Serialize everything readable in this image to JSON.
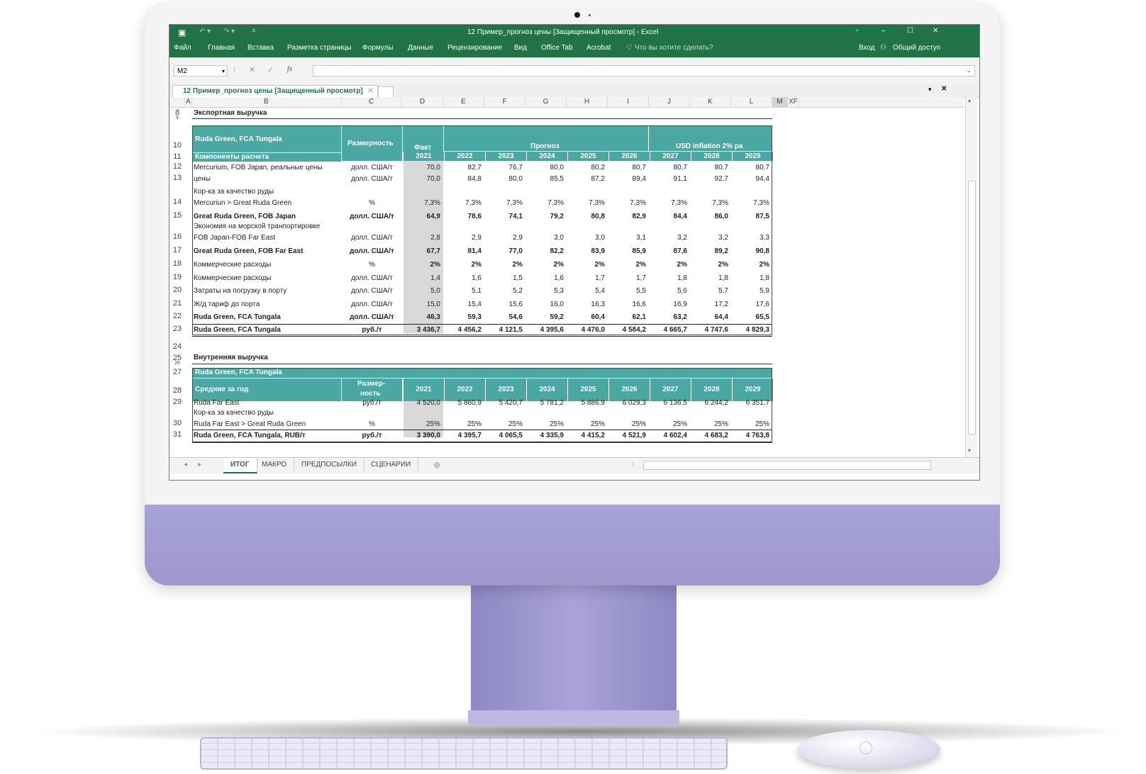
{
  "window": {
    "title": "12 Пример_прогноз цены  [Защищенный просмотр] - Excel",
    "controls": [
      "▫",
      "–",
      "☐",
      "✕"
    ]
  },
  "ribbon": {
    "tabs": [
      "Файл",
      "Главная",
      "Вставка",
      "Разметка страницы",
      "Формулы",
      "Данные",
      "Рецензирование",
      "Вид",
      "Office Tab",
      "Acrobat"
    ],
    "tell_me": "Что вы хотите сделать?",
    "signin": "Вход",
    "share": "Общий доступ"
  },
  "formula_bar": {
    "name_box": "M2",
    "fx": "fx",
    "value": ""
  },
  "doc_tab": {
    "label": "12 Пример_прогноз цены  [Защищенный просмотр]"
  },
  "columns": [
    "A",
    "B",
    "C",
    "D",
    "E",
    "F",
    "G",
    "H",
    "I",
    "J",
    "K",
    "L",
    "M",
    "XF"
  ],
  "section1": {
    "title": "Экспортная выручка",
    "header_entity": "Ruda Green, FCA Tungala",
    "header_components": "Компоненты расчета",
    "header_unit": "Размерность",
    "header_fact": "Факт",
    "header_forecast": "Прогноз",
    "header_inflation": "USD inflation 2% pa",
    "years": [
      "2021",
      "2022",
      "2023",
      "2024",
      "2025",
      "2026",
      "2027",
      "2028",
      "2029"
    ],
    "rows": [
      {
        "num": "12",
        "label": "Mercurium, FOB Japan, реальные цены",
        "unit": "долл. США/т",
        "vals": [
          "70,0",
          "82,7",
          "76,7",
          "80,0",
          "80,2",
          "80,7",
          "80,7",
          "80,7",
          "80,7"
        ]
      },
      {
        "num": "13",
        "label": "цены",
        "unit": "долл. США/т",
        "vals": [
          "70,0",
          "84,8",
          "80,0",
          "85,5",
          "87,2",
          "89,4",
          "91,1",
          "92,7",
          "94,4"
        ]
      },
      {
        "num": "14",
        "label": "Кор-ка за качество руды",
        "label2": "Mercuriun > Great Ruda Green",
        "unit": "%",
        "vals": [
          "7,3%",
          "7,3%",
          "7,3%",
          "7,3%",
          "7,3%",
          "7,3%",
          "7,3%",
          "7,3%",
          "7,3%"
        ]
      },
      {
        "num": "15",
        "label": "Great Ruda Green, FOB Japan",
        "unit": "долл. США/т",
        "vals": [
          "64,9",
          "78,6",
          "74,1",
          "79,2",
          "80,8",
          "82,9",
          "84,4",
          "86,0",
          "87,5"
        ],
        "bold": true
      },
      {
        "num": "16",
        "label": "Экономия на морской транпортировке",
        "label2": "FOB Japan-FOB Far East",
        "unit": "долл. США/т",
        "vals": [
          "2,8",
          "2,9",
          "2,9",
          "3,0",
          "3,0",
          "3,1",
          "3,2",
          "3,2",
          "3,3"
        ]
      },
      {
        "num": "17",
        "label": "Great Ruda Green, FOB Far East",
        "unit": "долл. США/т",
        "vals": [
          "67,7",
          "81,4",
          "77,0",
          "82,2",
          "83,9",
          "85,9",
          "87,6",
          "89,2",
          "90,8"
        ],
        "bold": true
      },
      {
        "num": "18",
        "label": "Коммерческие расходы",
        "unit": "%",
        "vals": [
          "2%",
          "2%",
          "2%",
          "2%",
          "2%",
          "2%",
          "2%",
          "2%",
          "2%"
        ],
        "boldvals": true
      },
      {
        "num": "19",
        "label": "Коммерческие расходы",
        "unit": "долл. США/т",
        "vals": [
          "1,4",
          "1,6",
          "1,5",
          "1,6",
          "1,7",
          "1,7",
          "1,8",
          "1,8",
          "1,8"
        ]
      },
      {
        "num": "20",
        "label": "Затраты на погрузку в порту",
        "unit": "долл. США/т",
        "vals": [
          "5,0",
          "5,1",
          "5,2",
          "5,3",
          "5,4",
          "5,5",
          "5,6",
          "5,7",
          "5,9"
        ]
      },
      {
        "num": "21",
        "label": "Ж/д тариф до порта",
        "unit": "долл. США/т",
        "vals": [
          "15,0",
          "15,4",
          "15,6",
          "16,0",
          "16,3",
          "16,6",
          "16,9",
          "17,2",
          "17,6"
        ]
      },
      {
        "num": "22",
        "label": "Ruda Green, FCA Tungala",
        "unit": "долл. США/т",
        "vals": [
          "46,3",
          "59,3",
          "54,6",
          "59,2",
          "60,4",
          "62,1",
          "63,2",
          "64,4",
          "65,5"
        ],
        "bold": true
      },
      {
        "num": "23",
        "label": "Ruda Green, FCA Tungala",
        "unit": "руб./т",
        "vals": [
          "3 436,7",
          "4 456,2",
          "4 121,5",
          "4 395,6",
          "4 476,0",
          "4 584,2",
          "4 665,7",
          "4 747,6",
          "4 829,3"
        ],
        "bold": true
      }
    ]
  },
  "section2": {
    "title": "Внутренняя выручка",
    "header_entity": "Ruda Green, FCA Tungala",
    "header_avg": "Средние за год",
    "header_unit_1": "Размер-",
    "header_unit_2": "ность",
    "years": [
      "2021",
      "2022",
      "2023",
      "2024",
      "2025",
      "2026",
      "2027",
      "2028",
      "2029"
    ],
    "rows": [
      {
        "num": "29",
        "label": "Ruda Far East",
        "unit": "руб./т",
        "vals": [
          "4 520,0",
          "5 860,9",
          "5 420,7",
          "5 781,2",
          "5 886,9",
          "6 029,3",
          "6 136,5",
          "6 244,2",
          "6 351,7"
        ]
      },
      {
        "num": "30",
        "label": "Кор-ка за качество руды",
        "label2": "Ruda Far East > Great Ruda Green",
        "unit": "%",
        "vals": [
          "25%",
          "25%",
          "25%",
          "25%",
          "25%",
          "25%",
          "25%",
          "25%",
          "25%"
        ]
      },
      {
        "num": "31",
        "label": "Ruda Green, FCA Tungala, RUB/т",
        "unit": "руб./т",
        "vals": [
          "3 390,0",
          "4 395,7",
          "4 065,5",
          "4 335,9",
          "4 415,2",
          "4 521,9",
          "4 602,4",
          "4 683,2",
          "4 763,8"
        ],
        "bold": true
      }
    ]
  },
  "row_numbers": {
    "r8": "8",
    "r9": "9",
    "r10": "10",
    "r11": "11",
    "r24": "24",
    "r25": "25",
    "r26": "26",
    "r27": "27",
    "r28": "28"
  },
  "sheets": [
    "ИТОГ",
    "МАКРО",
    "ПРЕДПОСЫЛКИ",
    "СЦЕНАРИИ"
  ],
  "active_sheet": "ИТОГ",
  "colors": {
    "excel_green": "#217346",
    "header_teal": "#4aa7a1",
    "fact_gray": "#d9d9d9",
    "monitor": "#a49ed2"
  }
}
